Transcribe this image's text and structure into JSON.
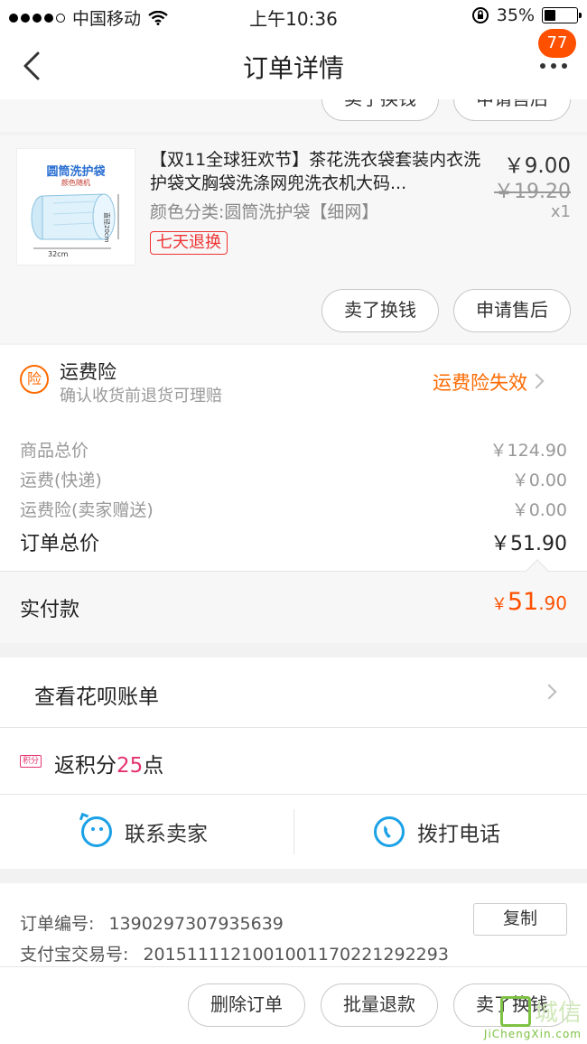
{
  "status_bar": {
    "carrier": "中国移动",
    "time": "上午10:36",
    "battery": "35%",
    "battery_level": 0.35
  },
  "nav": {
    "title": "订单详情",
    "badge": "77"
  },
  "top_actions": {
    "sell_label": "卖了换钱",
    "aftersale_label": "申请售后"
  },
  "product": {
    "title": "【双11全球狂欢节】茶花洗衣袋套装内衣洗护袋文胸袋洗涤网兜洗衣机大码...",
    "spec": "颜色分类:圆筒洗护袋【细网】",
    "tag": "七天退换",
    "price": "￥9.00",
    "original_price": "￥19.20",
    "quantity": "x1",
    "thumb_label": "圆筒洗护袋",
    "thumb_sub": "颜色随机",
    "thumb_width": "32cm",
    "thumb_height": "直径20cm",
    "sell_label": "卖了换钱",
    "aftersale_label": "申请售后"
  },
  "insurance": {
    "icon_text": "险",
    "title": "运费险",
    "subtitle": "确认收货前退货可理赔",
    "status": "运费险失效"
  },
  "summary": {
    "rows": [
      {
        "label": "商品总价",
        "value": "￥124.90"
      },
      {
        "label": "运费(快递)",
        "value": "￥0.00"
      },
      {
        "label": "运费险(卖家赠送)",
        "value": "￥0.00"
      }
    ],
    "total_label": "订单总价",
    "total_value": "￥51.90",
    "paid_label": "实付款",
    "paid_currency": "￥",
    "paid_int": "51",
    "paid_dec": ".90"
  },
  "huabei": {
    "label": "查看花呗账单"
  },
  "points": {
    "icon_text": "积分",
    "prefix": "返积分",
    "value": "25",
    "suffix": "点"
  },
  "contact": {
    "seller_label": "联系卖家",
    "phone_label": "拨打电话"
  },
  "order_info": {
    "order_no_label": "订单编号:",
    "order_no": "1390297307935639",
    "alipay_label": "支付宝交易号:",
    "alipay_no": "2015111121001001170221292293",
    "copy_label": "复制"
  },
  "footer": {
    "delete_label": "删除订单",
    "batch_refund_label": "批量退款",
    "sell_label": "卖了换钱"
  },
  "watermark": {
    "text": "城信",
    "url": "JiChengXin.com"
  },
  "colors": {
    "accent": "#ff5000",
    "insurance": "#ff6a00",
    "points": "#e5336e",
    "contact_icon": "#1aa1e6"
  }
}
